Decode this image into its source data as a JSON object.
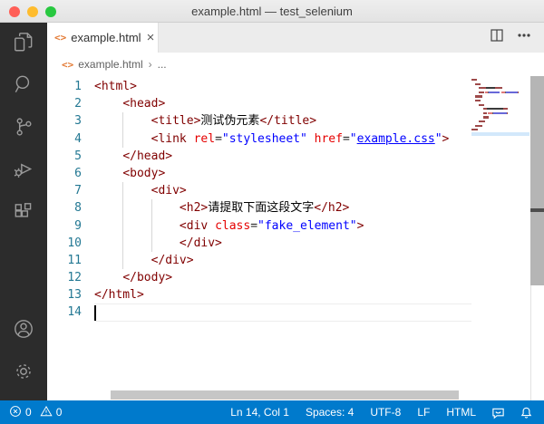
{
  "window": {
    "title": "example.html — test_selenium"
  },
  "colors": {
    "accent": "#007acc",
    "activity_bar": "#2c2c2c",
    "tag": "#800000",
    "attribute": "#e50000",
    "string": "#0000ff",
    "line_number": "#237893",
    "traffic_red": "#ff5f57",
    "traffic_yellow": "#febc2e",
    "traffic_green": "#28c840",
    "minimap_map": {
      "tag": "#9e4a4a",
      "attr": "#e07a7a",
      "str": "#6868d8",
      "link": "#6868d8",
      "text": "#3a3a3a",
      "punct": "#666666",
      "plain": ""
    }
  },
  "activity_bar": {
    "top": [
      {
        "name": "explorer-icon",
        "label": "Explorer"
      },
      {
        "name": "search-icon",
        "label": "Search"
      },
      {
        "name": "source-control-icon",
        "label": "Source Control"
      },
      {
        "name": "run-debug-icon",
        "label": "Run and Debug"
      },
      {
        "name": "extensions-icon",
        "label": "Extensions"
      }
    ],
    "bottom": [
      {
        "name": "account-icon",
        "label": "Accounts"
      },
      {
        "name": "settings-icon",
        "label": "Manage"
      }
    ]
  },
  "tab_bar": {
    "tab": {
      "icon": "<>",
      "label": "example.html",
      "close": "×"
    }
  },
  "breadcrumb": {
    "icon": "<>",
    "file": "example.html",
    "separator": "›",
    "more": "..."
  },
  "editor": {
    "cursor_line": 14,
    "lines": [
      {
        "n": 1,
        "indent": 0,
        "tokens": [
          {
            "t": "<html>",
            "s": "tag"
          }
        ]
      },
      {
        "n": 2,
        "indent": 4,
        "tokens": [
          {
            "t": "<head>",
            "s": "tag"
          }
        ]
      },
      {
        "n": 3,
        "indent": 8,
        "tokens": [
          {
            "t": "<title>",
            "s": "tag"
          },
          {
            "t": "测试伪元素",
            "s": "text"
          },
          {
            "t": "</title>",
            "s": "tag"
          }
        ]
      },
      {
        "n": 4,
        "indent": 8,
        "tokens": [
          {
            "t": "<link",
            "s": "tag"
          },
          {
            "t": " ",
            "s": "plain"
          },
          {
            "t": "rel",
            "s": "attr"
          },
          {
            "t": "=",
            "s": "punct"
          },
          {
            "t": "\"stylesheet\"",
            "s": "str"
          },
          {
            "t": " ",
            "s": "plain"
          },
          {
            "t": "href",
            "s": "attr"
          },
          {
            "t": "=",
            "s": "punct"
          },
          {
            "t": "\"",
            "s": "str"
          },
          {
            "t": "example.css",
            "s": "link"
          },
          {
            "t": "\"",
            "s": "str"
          },
          {
            "t": ">",
            "s": "tag"
          }
        ]
      },
      {
        "n": 5,
        "indent": 4,
        "tokens": [
          {
            "t": "</head>",
            "s": "tag"
          }
        ]
      },
      {
        "n": 6,
        "indent": 4,
        "tokens": [
          {
            "t": "<body>",
            "s": "tag"
          }
        ]
      },
      {
        "n": 7,
        "indent": 8,
        "tokens": [
          {
            "t": "<div>",
            "s": "tag"
          }
        ]
      },
      {
        "n": 8,
        "indent": 12,
        "tokens": [
          {
            "t": "<h2>",
            "s": "tag"
          },
          {
            "t": "请提取下面这段文字",
            "s": "text"
          },
          {
            "t": "</h2>",
            "s": "tag"
          }
        ]
      },
      {
        "n": 9,
        "indent": 12,
        "tokens": [
          {
            "t": "<div",
            "s": "tag"
          },
          {
            "t": " ",
            "s": "plain"
          },
          {
            "t": "class",
            "s": "attr"
          },
          {
            "t": "=",
            "s": "punct"
          },
          {
            "t": "\"fake_element\"",
            "s": "str"
          },
          {
            "t": ">",
            "s": "tag"
          }
        ]
      },
      {
        "n": 10,
        "indent": 12,
        "tokens": [
          {
            "t": "</div>",
            "s": "tag"
          }
        ]
      },
      {
        "n": 11,
        "indent": 8,
        "tokens": [
          {
            "t": "</div>",
            "s": "tag"
          }
        ]
      },
      {
        "n": 12,
        "indent": 4,
        "tokens": [
          {
            "t": "</body>",
            "s": "tag"
          }
        ]
      },
      {
        "n": 13,
        "indent": 0,
        "tokens": [
          {
            "t": "</html>",
            "s": "tag"
          }
        ]
      },
      {
        "n": 14,
        "indent": 0,
        "tokens": []
      }
    ]
  },
  "status_bar": {
    "errors": "0",
    "warnings": "0",
    "cursor_position": "Ln 14, Col 1",
    "indentation": "Spaces: 4",
    "encoding": "UTF-8",
    "eol": "LF",
    "language": "HTML"
  }
}
